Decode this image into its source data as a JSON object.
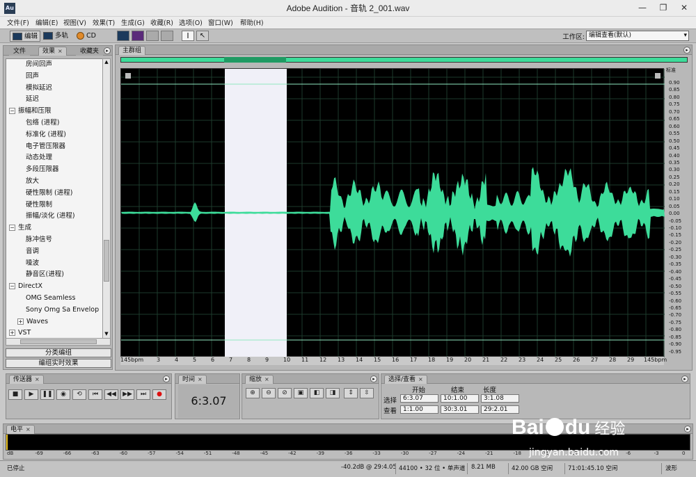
{
  "window": {
    "logo": "Au",
    "title": "Adobe Audition - 音轨 2_001.wav",
    "minimize_glyph": "—",
    "restore_glyph": "❐",
    "close_glyph": "✕"
  },
  "menu": [
    "文件(F)",
    "编辑(E)",
    "视图(V)",
    "效果(T)",
    "生成(G)",
    "收藏(R)",
    "选项(O)",
    "窗口(W)",
    "帮助(H)"
  ],
  "toolbar": {
    "edit_label": "编辑",
    "multitrack_label": "多轨",
    "cd_label": "CD",
    "workspace_label": "工作区:",
    "workspace_value": "编辑查看(默认)"
  },
  "left_panel": {
    "tabs": [
      "文件",
      "效果",
      "收藏夹"
    ],
    "tree": [
      {
        "label": "房间回声",
        "indent": 2
      },
      {
        "label": "回声",
        "indent": 2
      },
      {
        "label": "模拟延迟",
        "indent": 2
      },
      {
        "label": "延迟",
        "indent": 2
      },
      {
        "label": "振幅和压限",
        "indent": 0,
        "expander": "−"
      },
      {
        "label": "包络 (进程)",
        "indent": 2
      },
      {
        "label": "标准化 (进程)",
        "indent": 2
      },
      {
        "label": "电子管压限器",
        "indent": 2
      },
      {
        "label": "动态处理",
        "indent": 2
      },
      {
        "label": "多段压限器",
        "indent": 2
      },
      {
        "label": "放大",
        "indent": 2
      },
      {
        "label": "硬性限制 (进程)",
        "indent": 2
      },
      {
        "label": "硬性限制",
        "indent": 2
      },
      {
        "label": "振幅/淡化 (进程)",
        "indent": 2
      },
      {
        "label": "生成",
        "indent": 0,
        "expander": "−"
      },
      {
        "label": "脉冲信号",
        "indent": 2
      },
      {
        "label": "音调",
        "indent": 2
      },
      {
        "label": "噪波",
        "indent": 2
      },
      {
        "label": "静音区(进程)",
        "indent": 2
      },
      {
        "label": "DirectX",
        "indent": 0,
        "expander": "−"
      },
      {
        "label": "OMG Seamless",
        "indent": 2
      },
      {
        "label": "Sony Omg Sa Envelop",
        "indent": 2
      },
      {
        "label": "Waves",
        "indent": 1,
        "expander": "+"
      },
      {
        "label": "VST",
        "indent": 0,
        "expander": "+"
      }
    ],
    "group_button": "分类编组",
    "realtime_button": "编组实时效果"
  },
  "main": {
    "tab": "主群组",
    "ruler_ticks": [
      "145bpm",
      "3",
      "4",
      "5",
      "6",
      "7",
      "8",
      "9",
      "10",
      "11",
      "12",
      "13",
      "14",
      "15",
      "16",
      "17",
      "18",
      "19",
      "20",
      "21",
      "22",
      "23",
      "24",
      "25",
      "26",
      "27",
      "28",
      "29",
      "145bpm"
    ],
    "y_title": "标准",
    "y_labels": [
      "0.90",
      "0.85",
      "0.80",
      "0.75",
      "0.70",
      "0.65",
      "0.60",
      "0.55",
      "0.50",
      "0.45",
      "0.40",
      "0.35",
      "0.30",
      "0.25",
      "0.20",
      "0.15",
      "0.10",
      "0.05",
      "0.00",
      "-0.05",
      "-0.10",
      "-0.15",
      "-0.20",
      "-0.25",
      "-0.30",
      "-0.35",
      "-0.40",
      "-0.45",
      "-0.50",
      "-0.55",
      "-0.60",
      "-0.65",
      "-0.70",
      "-0.75",
      "-0.80",
      "-0.85",
      "-0.90",
      "-0.95"
    ],
    "colors": {
      "waveform": "#3ddc9a",
      "background": "#000000",
      "selection": "#f0f0f8"
    }
  },
  "transport": {
    "tab": "传送器",
    "buttons": [
      "stop-icon",
      "play-icon",
      "pause-icon",
      "play-cursor-icon",
      "loop-icon",
      "go-start-icon",
      "rewind-icon",
      "fast-forward-icon",
      "go-end-icon",
      "record-icon"
    ]
  },
  "time": {
    "tab": "时间",
    "value": "6:3.07"
  },
  "zoom": {
    "tab": "缩放"
  },
  "selection_view": {
    "tab": "选择/查看",
    "col_start": "开始",
    "col_end": "结束",
    "col_length": "长度",
    "row_select": "选择",
    "row_view": "查看",
    "select_start": "6:3.07",
    "select_end": "10:1.00",
    "select_length": "3:1.08",
    "view_start": "1:1.00",
    "view_end": "30:3.01",
    "view_length": "29:2.01"
  },
  "level_meter": {
    "tab": "电平",
    "ticks": [
      "dB",
      "-69",
      "-66",
      "-63",
      "-60",
      "-57",
      "-54",
      "-51",
      "-48",
      "-45",
      "-42",
      "-39",
      "-36",
      "-33",
      "-30",
      "-27",
      "-24",
      "-21",
      "-18",
      "-15",
      "-12",
      "-9",
      "-6",
      "-3",
      "0"
    ]
  },
  "status": {
    "state": "已停止",
    "level": "-40.2dB @ 29:4.05",
    "format": "44100 • 32 位 • 单声道",
    "size": "8.21 MB",
    "free_space": "42.00 GB 空闲",
    "free_time": "71:01:45.10 空闲",
    "view_mode": "波形"
  },
  "watermark": {
    "brand": "Bai",
    "brand2": "du",
    "suffix": "经验",
    "url": "jingyan.baidu.com"
  }
}
